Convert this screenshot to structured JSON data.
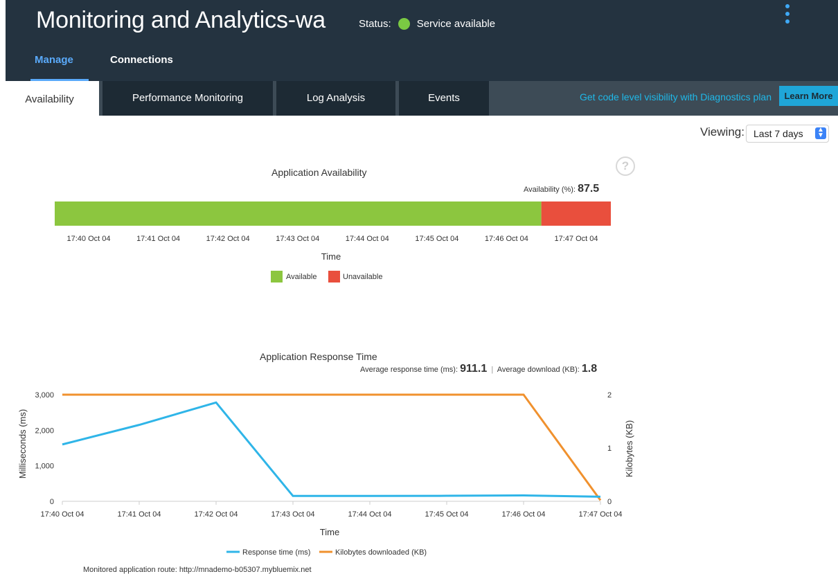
{
  "header": {
    "title": "Monitoring and Analytics-wa",
    "status_label": "Status:",
    "status_text": "Service available",
    "status_color": "#7ac943",
    "menu_icon": "kebab-icon",
    "tabs": [
      {
        "label": "Manage",
        "active": true
      },
      {
        "label": "Connections",
        "active": false
      }
    ]
  },
  "subnav": {
    "tabs": [
      {
        "label": "Availability",
        "active": true
      },
      {
        "label": "Performance Monitoring",
        "active": false
      },
      {
        "label": "Log Analysis",
        "active": false
      },
      {
        "label": "Events",
        "active": false
      }
    ],
    "promo_text": "Get code level visibility with Diagnostics plan",
    "learn_more": "Learn More"
  },
  "viewing": {
    "label": "Viewing:",
    "selected": "Last 7 days"
  },
  "help_icon": "help-icon",
  "availability": {
    "title": "Application Availability",
    "stat_label": "Availability (%):",
    "stat_value": "87.5",
    "xlabel": "Time",
    "ticks": [
      "17:40 Oct 04",
      "17:41 Oct 04",
      "17:42 Oct 04",
      "17:43 Oct 04",
      "17:44 Oct 04",
      "17:45 Oct 04",
      "17:46 Oct 04",
      "17:47 Oct 04"
    ],
    "legend": [
      {
        "name": "Available",
        "color": "#8cc63f"
      },
      {
        "name": "Unavailable",
        "color": "#e94f3d"
      }
    ]
  },
  "response": {
    "title": "Application Response Time",
    "avg_rt_label": "Average response time (ms):",
    "avg_rt_value": "911.1",
    "avg_dl_label": "Average download (KB):",
    "avg_dl_value": "1.8",
    "xlabel": "Time",
    "ylabel_left": "Milliseconds (ms)",
    "ylabel_right": "Kilobytes (KB)",
    "left_ticks": [
      "3,000",
      "2,000",
      "1,000",
      "0"
    ],
    "right_ticks": [
      "2",
      "1",
      "0"
    ],
    "x_ticks": [
      "17:40 Oct 04",
      "17:41 Oct 04",
      "17:42 Oct 04",
      "17:43 Oct 04",
      "17:44 Oct 04",
      "17:45 Oct 04",
      "17:46 Oct 04",
      "17:47 Oct 04"
    ],
    "legend": [
      {
        "name": "Response time (ms)",
        "color": "#2fb5e8"
      },
      {
        "name": "Kilobytes downloaded (KB)",
        "color": "#f0912e"
      }
    ]
  },
  "chart_data": [
    {
      "type": "bar",
      "title": "Application Availability",
      "xlabel": "Time",
      "ylabel": "",
      "categories": [
        "17:40 Oct 04",
        "17:41 Oct 04",
        "17:42 Oct 04",
        "17:43 Oct 04",
        "17:44 Oct 04",
        "17:45 Oct 04",
        "17:46 Oct 04",
        "17:47 Oct 04"
      ],
      "series": [
        {
          "name": "Available",
          "values": [
            1,
            1,
            1,
            1,
            1,
            1,
            1,
            0
          ],
          "color": "#8cc63f"
        },
        {
          "name": "Unavailable",
          "values": [
            0,
            0,
            0,
            0,
            0,
            0,
            0,
            1
          ],
          "color": "#e94f3d"
        }
      ],
      "availability_percent": 87.5,
      "legend": "bottom"
    },
    {
      "type": "line",
      "title": "Application Response Time",
      "xlabel": "Time",
      "ylabel": "Milliseconds (ms)",
      "y2label": "Kilobytes (KB)",
      "x": [
        "17:40 Oct 04",
        "17:41 Oct 04",
        "17:42 Oct 04",
        "17:43 Oct 04",
        "17:44 Oct 04",
        "17:45 Oct 04",
        "17:46 Oct 04",
        "17:47 Oct 04"
      ],
      "ylim": [
        0,
        3000
      ],
      "y2lim": [
        0,
        2
      ],
      "series": [
        {
          "name": "Response time (ms)",
          "axis": "left",
          "color": "#2fb5e8",
          "values": [
            1600,
            2150,
            2780,
            150,
            150,
            155,
            165,
            130
          ]
        },
        {
          "name": "Kilobytes downloaded (KB)",
          "axis": "right",
          "color": "#f0912e",
          "values": [
            2,
            2,
            2,
            2,
            2,
            2,
            2,
            0.02
          ]
        }
      ],
      "grid": false,
      "legend": "bottom"
    }
  ],
  "route": {
    "label": "Monitored application route:",
    "url": "http://mnademo-b05307.mybluemix.net"
  }
}
